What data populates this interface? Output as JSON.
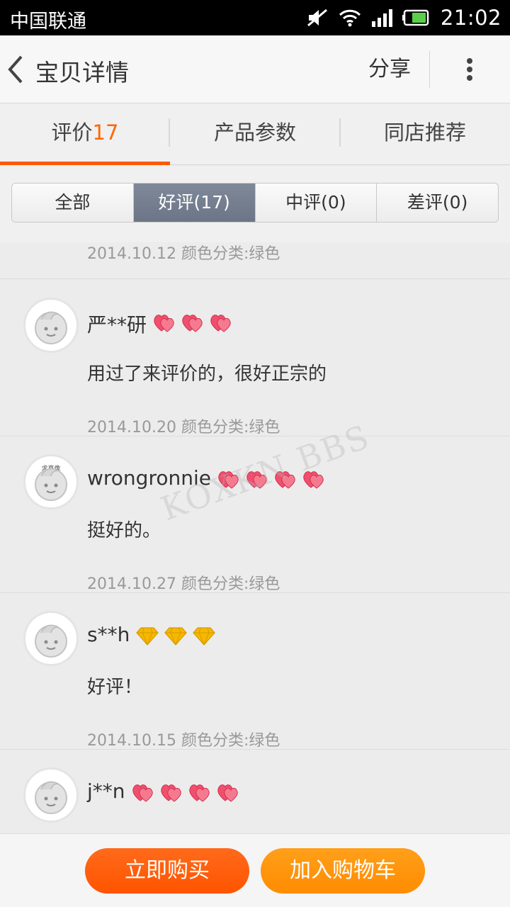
{
  "status_bar": {
    "carrier": "中国联通",
    "time": "21:02"
  },
  "header": {
    "title": "宝贝详情",
    "share_label": "分享"
  },
  "tabs": [
    {
      "label": "评价",
      "count": "17",
      "active": true
    },
    {
      "label": "产品参数"
    },
    {
      "label": "同店推荐"
    }
  ],
  "filters": [
    {
      "label": "全部"
    },
    {
      "label": "好评(17)",
      "active": true
    },
    {
      "label": "中评(0)"
    },
    {
      "label": "差评(0)"
    }
  ],
  "partial_review": {
    "meta": "2014.10.12 颜色分类:绿色"
  },
  "reviews": [
    {
      "user": "严**研",
      "badge_type": "heart",
      "badge_count": 3,
      "content": "用过了来评价的，很好正宗的",
      "meta": "2014.10.20 颜色分类:绿色",
      "avatar_caption": ""
    },
    {
      "user": "wrongronnie",
      "badge_type": "heart",
      "badge_count": 4,
      "content": "挺好的。",
      "meta": "2014.10.27 颜色分类:绿色",
      "avatar_caption": "求真像"
    },
    {
      "user": "s**h",
      "badge_type": "diamond",
      "badge_count": 3,
      "content": "好评！",
      "meta": "2014.10.15 颜色分类:绿色",
      "avatar_caption": ""
    },
    {
      "user": "j**n",
      "badge_type": "heart",
      "badge_count": 4,
      "content": "",
      "meta": "",
      "avatar_caption": ""
    }
  ],
  "watermark": "KOXKN BBS",
  "actions": {
    "buy_now": "立即购买",
    "add_to_cart": "加入购物车"
  },
  "colors": {
    "accent": "#ff5a00",
    "buy": "#ff5a00",
    "cart": "#ff9500",
    "active_filter": "#737d8f",
    "heart": "#f0506e",
    "diamond": "#f5b800"
  }
}
